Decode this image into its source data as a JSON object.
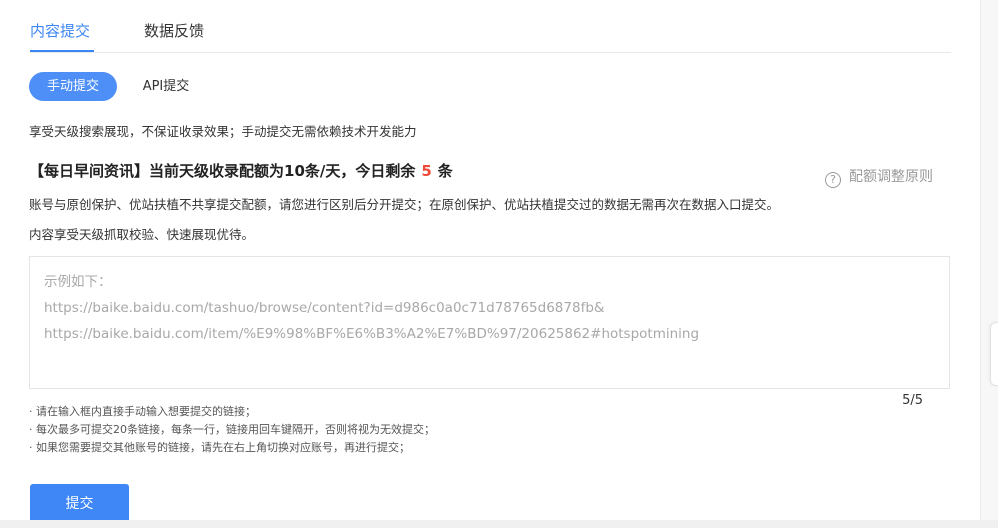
{
  "tabs": [
    {
      "label": "内容提交",
      "active": true
    },
    {
      "label": "数据反馈",
      "active": false
    }
  ],
  "modes": [
    {
      "label": "手动提交",
      "active": true
    },
    {
      "label": "API提交",
      "active": false
    }
  ],
  "intro": "享受天级搜索展现，不保证收录效果；手动提交无需依赖技术开发能力",
  "headline": {
    "prefix": "【每日早间资讯】当前天级收录配额为10条/天，今日剩余",
    "remaining": "5",
    "suffix": "条"
  },
  "rule_link": {
    "icon": "question-circle-icon",
    "label": "配额调整原则"
  },
  "desc_lines": [
    "账号与原创保护、优站扶植不共享提交配额，请您进行区别后分开提交；在原创保护、优站扶植提交过的数据无需再次在数据入口提交。",
    "内容享受天级抓取校验、快速展现优待。"
  ],
  "textarea": {
    "placeholder_lines": [
      "示例如下：",
      "https://baike.baidu.com/tashuo/browse/content?id=d986c0a0c71d78765d6878fb&",
      "https://baike.baidu.com/item/%E9%98%BF%E6%B3%A2%E7%BD%97/20625862#hotspotmining"
    ]
  },
  "counter": "5/5",
  "notes": [
    "· 请在输入框内直接手动输入想要提交的链接；",
    "· 每次最多可提交20条链接，每条一行，链接用回车键隔开，否则将视为无效提交；",
    "· 如果您需要提交其他账号的链接，请先在右上角切换对应账号，再进行提交；"
  ],
  "submit_label": "提交",
  "colors": {
    "accent": "#3c85f5",
    "warning": "#ee4a3c"
  }
}
